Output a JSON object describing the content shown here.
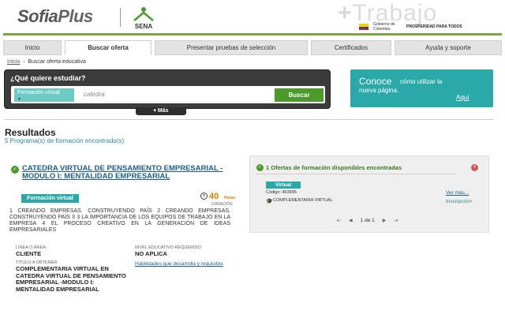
{
  "header": {
    "logo_sofia": "Sofia",
    "logo_plus": "Plus",
    "sena_label": "SENA",
    "trabajo_text": "Trabajo",
    "gov_text": "Gobierno de Colombia",
    "prosperidad_text": "PROSPERIDAD PARA TODOS"
  },
  "nav": {
    "tabs": [
      {
        "label": "Inicio"
      },
      {
        "label": "Buscar oferta"
      },
      {
        "label": "Presentar pruebas de selección"
      },
      {
        "label": "Certificados"
      },
      {
        "label": "Ayuda y soporte"
      }
    ]
  },
  "breadcrumb": {
    "home": "Inicio",
    "current": "Buscar oferta educativa"
  },
  "search": {
    "title": "¿Qué quiere estudiar?",
    "tag_label": "Formación virtual",
    "placeholder": "catedra",
    "button_label": "Buscar",
    "more_label": "▾ Más"
  },
  "conoce": {
    "big": "Conoce",
    "line1": "cómo utilizar la",
    "line2": "nueva página.",
    "link": "Aquí"
  },
  "results": {
    "title": "Resultados",
    "count": "5 Programa(s) de formación encontrado(s)",
    "program": {
      "title": "CATEDRA VIRTUAL DE PENSAMIENTO EMPRESARIAL -MODULO I: MENTALIDAD EMPRESARIAL",
      "modality": "Formación virtual",
      "hours": "40",
      "hours_unit": "Horas",
      "duration_label": "DURACIÓN",
      "description": "1 CREANDO EMPRESAS. CONSTRUYENDO PAÍS 2 CREANDO EMPRESAS. CONSTRUYENDO PAÍS II 3 LA IMPORTANCIA DE LOS EQUIPOS DE TRABAJO EN LA EMPRESA 4 EL PROCESO CREATIVO EN LA GENERACIÓN DE IDEAS EMPRESARIALES",
      "linea_label": "LÍNEA O ÁREA:",
      "linea_value": "CLIENTE",
      "nivel_label": "NIVEL EDUCATIVO REQUERIDO:",
      "nivel_value": "NO APLICA",
      "titulo_label": "TITULO A OBTENER:",
      "titulo_value": "COMPLEMENTARIA VIRTUAL EN CATEDRA VIRTUAL DE PENSAMIENTO EMPRESARIAL -MODULO I: MENTALIDAD EMPRESARIAL",
      "habilidades_link": "Habilidades que desarrolla y requisitos"
    },
    "offers": {
      "title": "1 Ofertas de formación disponibles encontradas",
      "badge": "Virtual",
      "code": "Código: 463995",
      "modality": "COMPLEMENTARIA VIRTUAL",
      "ver_mas": "Ver más...",
      "inscripcion": "Inscripción",
      "pager": "1 de 1"
    }
  },
  "colors": {
    "accent_green": "#4a9b2a",
    "teal": "#2aa9a8",
    "link_blue": "#1f5d86",
    "orange": "#e07b00"
  }
}
